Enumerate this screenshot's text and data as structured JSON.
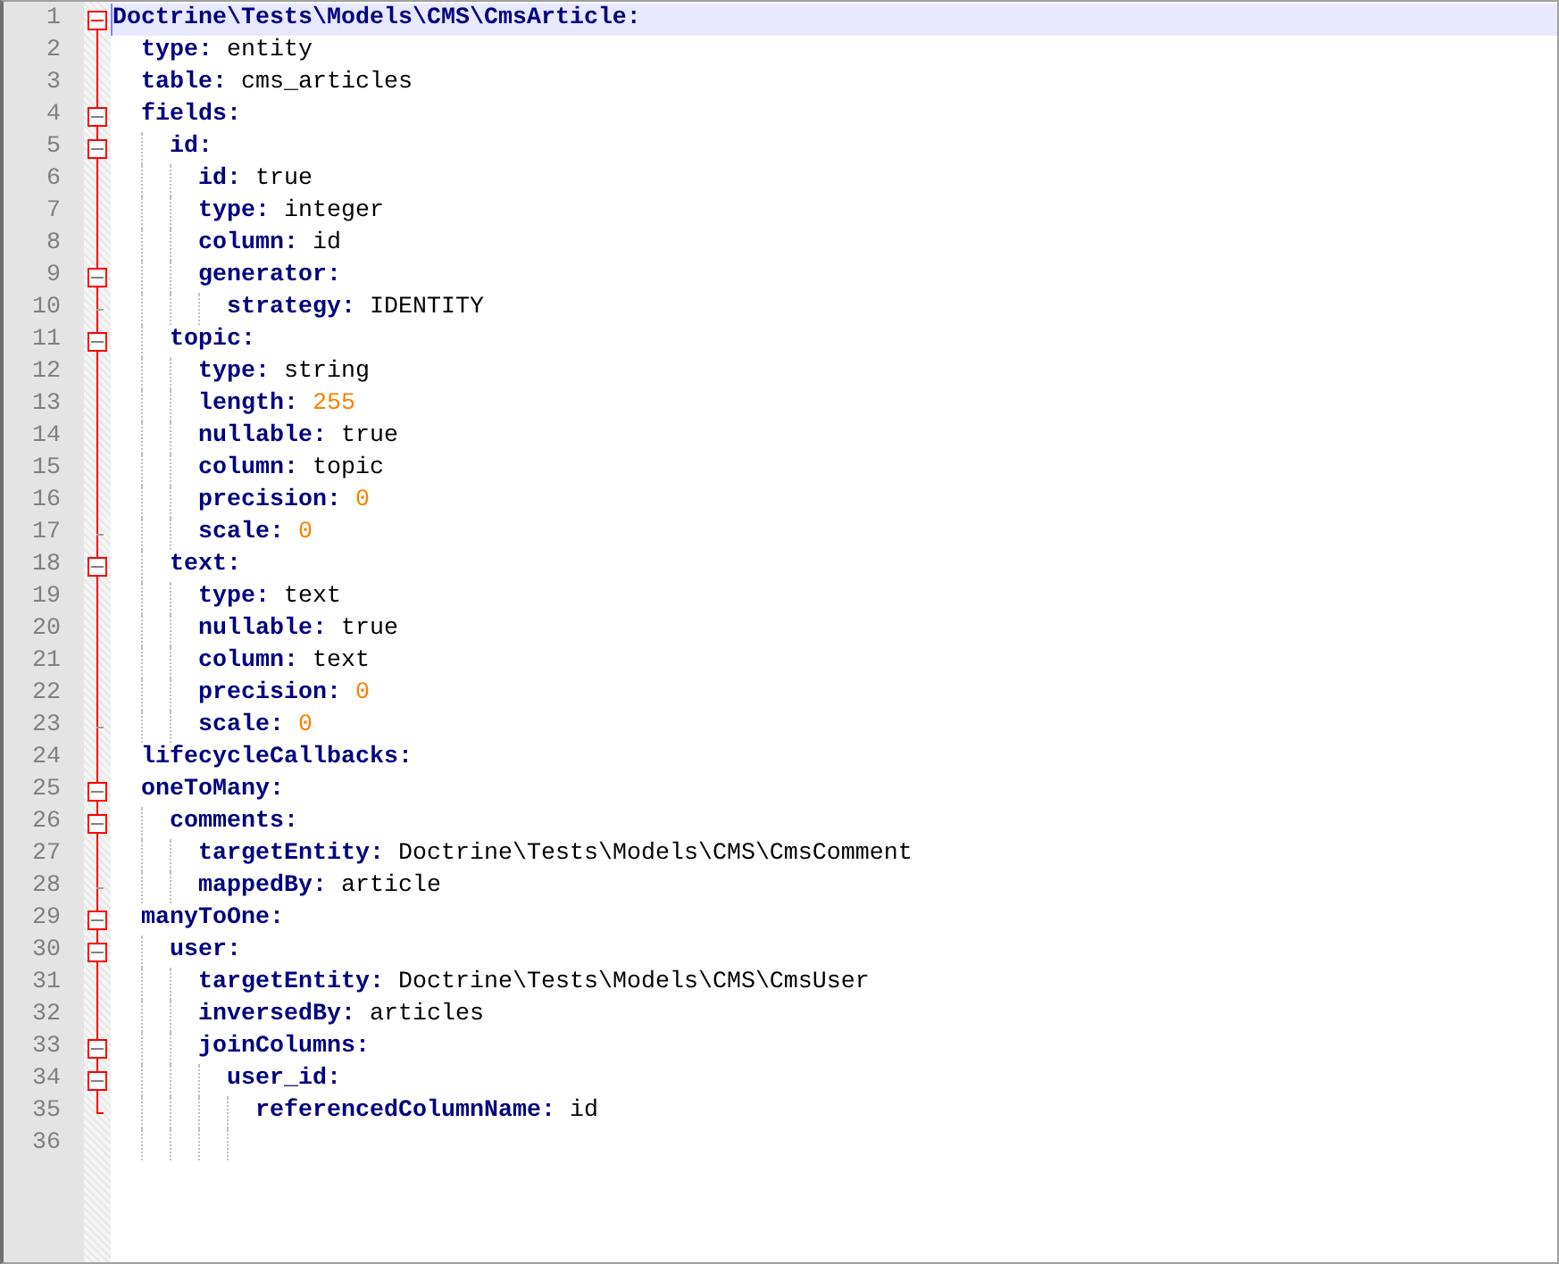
{
  "editor": {
    "line_numbers": [
      "1",
      "2",
      "3",
      "4",
      "5",
      "6",
      "7",
      "8",
      "9",
      "10",
      "11",
      "12",
      "13",
      "14",
      "15",
      "16",
      "17",
      "18",
      "19",
      "20",
      "21",
      "22",
      "23",
      "24",
      "25",
      "26",
      "27",
      "28",
      "29",
      "30",
      "31",
      "32",
      "33",
      "34",
      "35",
      "36"
    ],
    "root": {
      "key": "Doctrine\\Tests\\Models\\CMS\\CmsArticle:",
      "current": true,
      "expanded": true,
      "children": [
        {
          "key": "type:",
          "value": "entity",
          "kind": "scalar",
          "current": false
        },
        {
          "key": "table:",
          "value": "cms_articles",
          "kind": "scalar",
          "current": false
        },
        {
          "key": "fields:",
          "current": false,
          "expanded": true,
          "children": [
            {
              "key": "id:",
              "current": false,
              "expanded": true,
              "children": [
                {
                  "key": "id:",
                  "value": "true",
                  "kind": "scalar",
                  "current": false
                },
                {
                  "key": "type:",
                  "value": "integer",
                  "kind": "scalar",
                  "current": false
                },
                {
                  "key": "column:",
                  "value": "id",
                  "kind": "scalar",
                  "current": false
                },
                {
                  "key": "generator:",
                  "current": false,
                  "expanded": true,
                  "children": [
                    {
                      "key": "strategy:",
                      "value": "IDENTITY",
                      "kind": "scalar",
                      "current": false
                    }
                  ]
                }
              ]
            },
            {
              "key": "topic:",
              "current": false,
              "expanded": true,
              "children": [
                {
                  "key": "type:",
                  "value": "string",
                  "kind": "scalar",
                  "current": false
                },
                {
                  "key": "length:",
                  "value": "255",
                  "kind": "number",
                  "current": false
                },
                {
                  "key": "nullable:",
                  "value": "true",
                  "kind": "scalar",
                  "current": false
                },
                {
                  "key": "column:",
                  "value": "topic",
                  "kind": "scalar",
                  "current": false
                },
                {
                  "key": "precision:",
                  "value": "0",
                  "kind": "number",
                  "current": false
                },
                {
                  "key": "scale:",
                  "value": "0",
                  "kind": "number",
                  "current": false
                }
              ]
            },
            {
              "key": "text:",
              "current": false,
              "expanded": true,
              "children": [
                {
                  "key": "type:",
                  "value": "text",
                  "kind": "scalar",
                  "current": false
                },
                {
                  "key": "nullable:",
                  "value": "true",
                  "kind": "scalar",
                  "current": false
                },
                {
                  "key": "column:",
                  "value": "text",
                  "kind": "scalar",
                  "current": false
                },
                {
                  "key": "precision:",
                  "value": "0",
                  "kind": "number",
                  "current": false
                },
                {
                  "key": "scale:",
                  "value": "0",
                  "kind": "number",
                  "current": false
                }
              ]
            }
          ]
        },
        {
          "key": "lifecycleCallbacks:",
          "current": false
        },
        {
          "key": "oneToMany:",
          "current": false,
          "expanded": true,
          "children": [
            {
              "key": "comments:",
              "current": false,
              "expanded": true,
              "children": [
                {
                  "key": "targetEntity:",
                  "value": "Doctrine\\Tests\\Models\\CMS\\CmsComment",
                  "kind": "scalar",
                  "current": false
                },
                {
                  "key": "mappedBy:",
                  "value": "article",
                  "kind": "scalar",
                  "current": false
                }
              ]
            }
          ]
        },
        {
          "key": "manyToOne:",
          "current": false,
          "expanded": true,
          "children": [
            {
              "key": "user:",
              "current": false,
              "expanded": true,
              "children": [
                {
                  "key": "targetEntity:",
                  "value": "Doctrine\\Tests\\Models\\CMS\\CmsUser",
                  "kind": "scalar",
                  "current": false
                },
                {
                  "key": "inversedBy:",
                  "value": "articles",
                  "kind": "scalar",
                  "current": false
                },
                {
                  "key": "joinColumns:",
                  "current": false,
                  "expanded": true,
                  "children": [
                    {
                      "key": "user_id:",
                      "current": false,
                      "expanded": true,
                      "children": [
                        {
                          "key": "referencedColumnName:",
                          "value": "id",
                          "kind": "scalar",
                          "current": false
                        }
                      ]
                    }
                  ]
                }
              ]
            }
          ]
        }
      ]
    }
  }
}
